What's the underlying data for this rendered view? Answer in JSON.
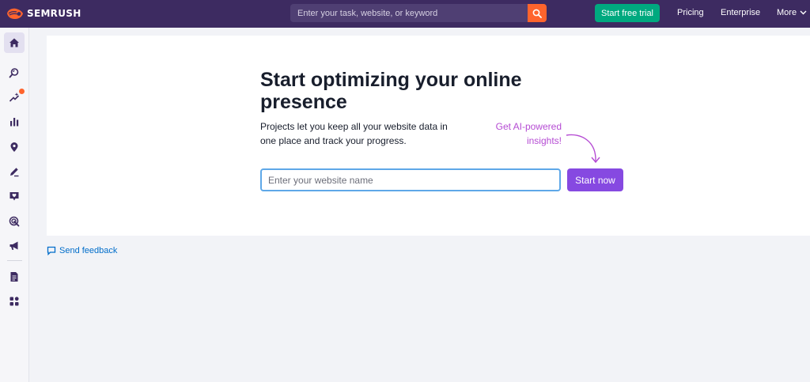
{
  "colors": {
    "topbar": "#3d2b61",
    "search_button": "#ff642d",
    "trial_button": "#00a97f",
    "start_button": "#8649e1",
    "ai_note": "#b54bd3",
    "link": "#006dca"
  },
  "topbar": {
    "logo_text": "SEMRUSH",
    "logo_icon": "semrush-fire-icon",
    "search_placeholder": "Enter your task, website, or keyword",
    "search_icon": "search-icon",
    "trial_label": "Start free trial",
    "pricing_label": "Pricing",
    "enterprise_label": "Enterprise",
    "more_label": "More",
    "more_icon": "chevron-down-icon"
  },
  "sidebar": {
    "items": [
      {
        "icon": "home-icon",
        "active": true
      },
      {
        "icon": "seo-search-icon"
      },
      {
        "icon": "ai-sparkle-icon",
        "badge": true
      },
      {
        "icon": "traffic-chart-icon"
      },
      {
        "icon": "local-pin-icon"
      },
      {
        "icon": "content-pen-icon"
      },
      {
        "icon": "review-heart-icon"
      },
      {
        "icon": "advertising-target-icon"
      },
      {
        "icon": "social-megaphone-icon"
      },
      {
        "icon": "reports-doc-icon"
      },
      {
        "icon": "apps-grid-icon"
      }
    ]
  },
  "main": {
    "headline": "Start optimizing your online presence",
    "description": "Projects let you keep all your website data in one place and track your progress.",
    "ai_note": "Get AI-powered insights!",
    "website_placeholder": "Enter your website name",
    "start_label": "Start now"
  },
  "feedback": {
    "label": "Send feedback",
    "icon": "comment-icon"
  }
}
